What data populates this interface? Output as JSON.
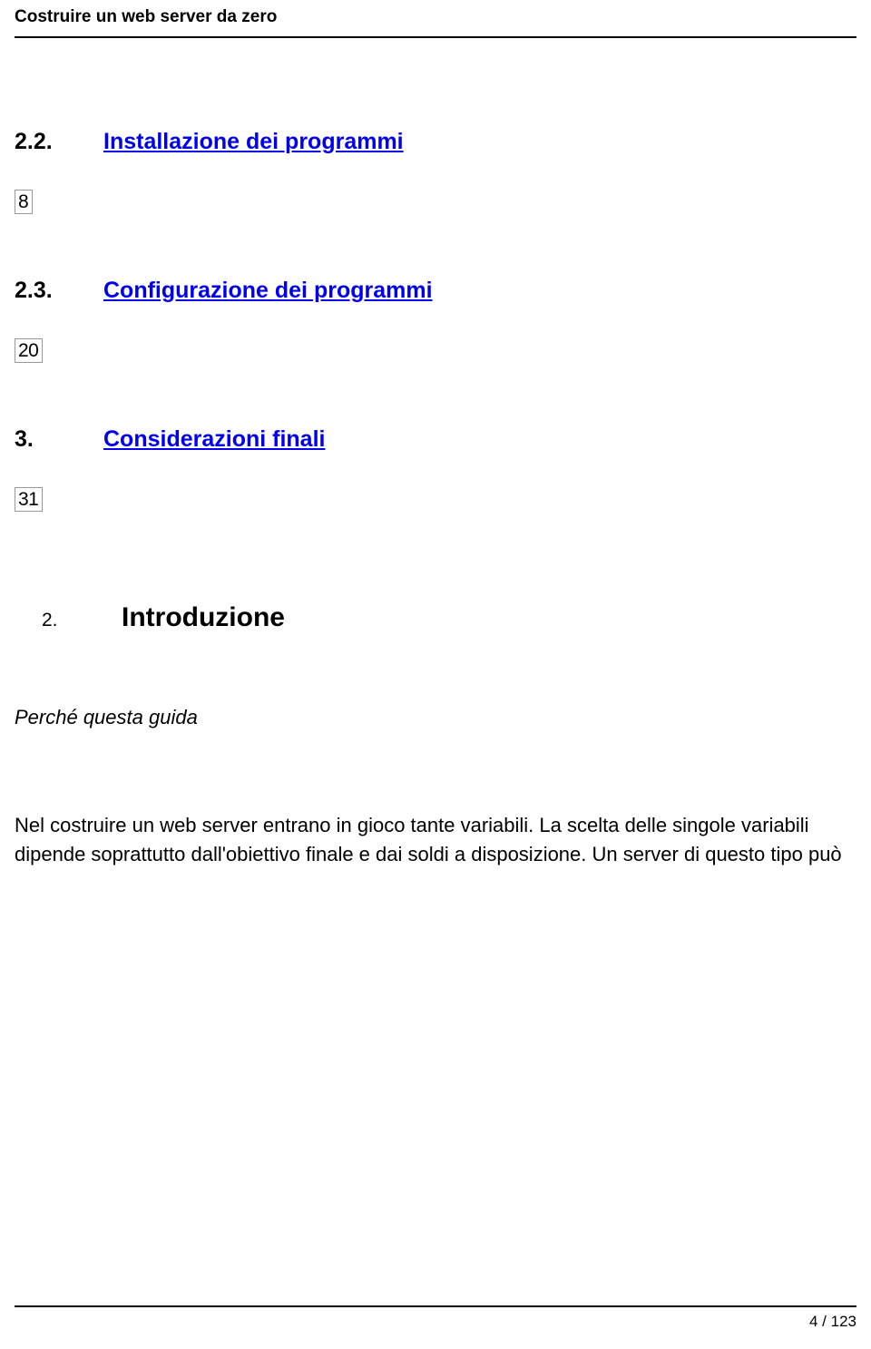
{
  "header": {
    "title": "Costruire un web server da zero"
  },
  "toc": [
    {
      "num": "2.2.",
      "label": "Installazione dei programmi",
      "page": "8"
    },
    {
      "num": "2.3.",
      "label": "Configurazione dei programmi",
      "page": "20"
    },
    {
      "num": "3.",
      "label": "Considerazioni finali",
      "page": "31"
    }
  ],
  "section": {
    "num": "2.",
    "title": "Introduzione"
  },
  "subtitle": "Perché questa guida",
  "body": "Nel costruire un web server entrano in gioco tante variabili. La scelta delle singole variabili dipende soprattutto dall'obiettivo finale e dai soldi a disposizione. Un server di questo tipo può",
  "footer": {
    "page": "4 / 123"
  }
}
